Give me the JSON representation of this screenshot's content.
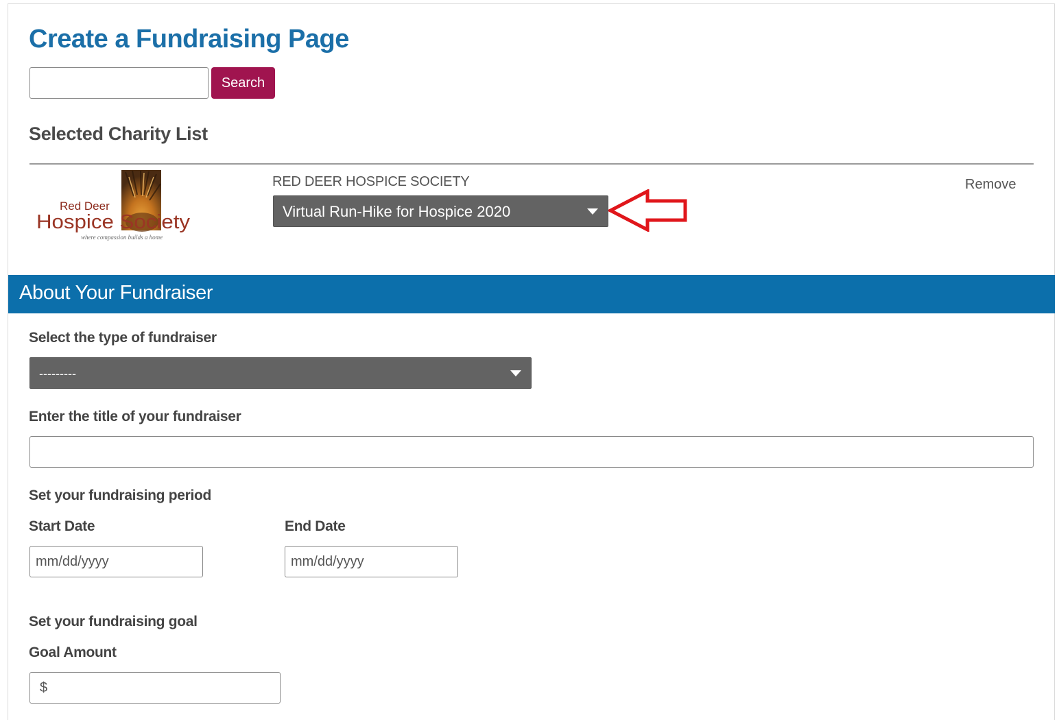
{
  "header": {
    "title": "Create a Fundraising Page"
  },
  "search": {
    "value": "",
    "button_label": "Search"
  },
  "charity_list": {
    "heading": "Selected Charity List",
    "charity": {
      "name": "RED DEER HOSPICE SOCIETY",
      "campaign_selected": "Virtual Run-Hike for Hospice 2020",
      "remove_label": "Remove",
      "logo": {
        "line1": "Red Deer",
        "line2": "Hospice Society",
        "tagline": "where compassion builds a home"
      }
    }
  },
  "about": {
    "banner_title": "About Your Fundraiser",
    "type_label": "Select the type of fundraiser",
    "type_selected": "---------",
    "title_label": "Enter the title of your fundraiser",
    "title_value": "",
    "period_label": "Set your fundraising period",
    "start_label": "Start Date",
    "start_placeholder": "mm/dd/yyyy",
    "end_label": "End Date",
    "end_placeholder": "mm/dd/yyyy",
    "goal_label": "Set your fundraising goal",
    "goal_amount_label": "Goal Amount",
    "goal_placeholder": "$"
  },
  "icons": {
    "dropdown": "caret-down-icon",
    "annotation": "red-outline-arrow-icon"
  },
  "colors": {
    "title_blue": "#1b6fa8",
    "search_button": "#a0144f",
    "banner_blue": "#0c6fab",
    "select_gray": "#636363",
    "annotation_red": "#e0161b"
  }
}
